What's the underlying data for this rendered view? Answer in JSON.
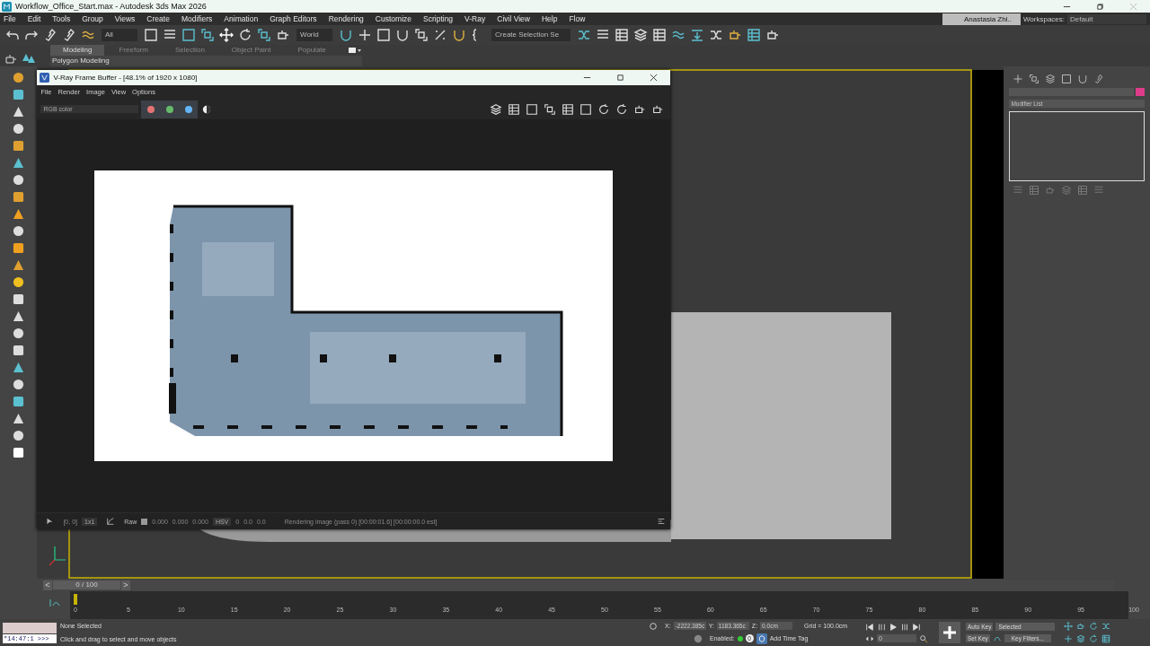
{
  "window": {
    "title": "Workflow_Office_Start.max - Autodesk 3ds Max 2026"
  },
  "menu": [
    "File",
    "Edit",
    "Tools",
    "Group",
    "Views",
    "Create",
    "Modifiers",
    "Animation",
    "Graph Editors",
    "Rendering",
    "Customize",
    "Scripting",
    "V-Ray",
    "Civil View",
    "Help",
    "Flow"
  ],
  "user": {
    "name": "Anastasia Zhi.."
  },
  "workspaces": {
    "label": "Workspaces:",
    "value": "Default"
  },
  "toolbar": {
    "selection_filter": "All",
    "reference_coord": "World",
    "named_selection": "Create Selection Se"
  },
  "ribbon": {
    "tabs": [
      {
        "label": "Modeling",
        "selected": true
      },
      {
        "label": "Freeform",
        "selected": false
      },
      {
        "label": "Selection",
        "selected": false
      },
      {
        "label": "Object Paint",
        "selected": false
      },
      {
        "label": "Populate",
        "selected": false
      }
    ],
    "panel": "Polygon Modeling"
  },
  "frame_buffer": {
    "title": "V-Ray Frame Buffer - [48.1% of 1920 x 1080]",
    "menu": [
      "File",
      "Render",
      "Image",
      "View",
      "Options"
    ],
    "channel": "RGB color",
    "channels": [
      {
        "color": "#e57373",
        "selected": true
      },
      {
        "color": "#66bb6a",
        "selected": true
      },
      {
        "color": "#64b5f6",
        "selected": true
      }
    ],
    "status": {
      "coords": "[0, 0]",
      "zoom": "1x1",
      "raw": "Raw",
      "rgb": [
        "0.000",
        "0.000",
        "0.000"
      ],
      "color_mode": "HSV",
      "hsv": [
        "0",
        "0.0",
        "0.0"
      ],
      "message": "Rendering image (pass 0) [00:00:01.6] [00:00:00.0 est]"
    }
  },
  "command_panel": {
    "modifier_list": "Modifier List"
  },
  "timeline": {
    "prev": "<",
    "next": ">",
    "frame": "0 / 100",
    "level": 0,
    "ticks": [
      "0",
      "5",
      "10",
      "15",
      "20",
      "25",
      "30",
      "35",
      "40",
      "45",
      "50",
      "55",
      "60",
      "65",
      "70",
      "75",
      "80",
      "85",
      "90",
      "95",
      "100"
    ]
  },
  "status": {
    "maxscript": "\"14:47:1 >>>",
    "selection": "None Selected",
    "prompt": "Click and drag to select and move objects",
    "x_label": "X:",
    "x": "-2222.385c",
    "y_label": "Y:",
    "y": "1183.365c",
    "z_label": "Z:",
    "z": "0.0cm",
    "grid": "Grid = 100.0cm",
    "enabled": "Enabled:",
    "time_tag_count": "0",
    "add_time_tag": "Add Time Tag",
    "auto_key": "Auto Key",
    "key_mode": "Selected",
    "set_key": "Set Key",
    "key_filters": "Key Filters...",
    "current_frame": "0"
  }
}
